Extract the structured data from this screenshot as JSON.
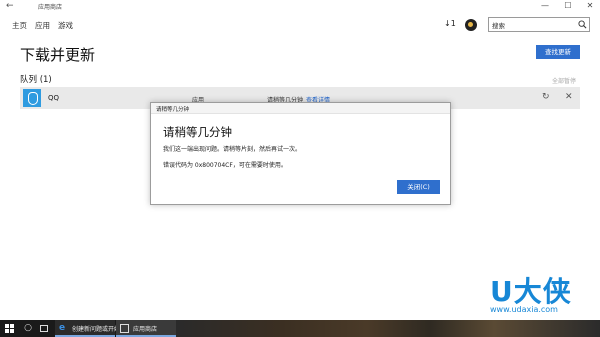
{
  "window": {
    "title": "应用商店",
    "back_icon": "back-arrow-icon",
    "controls": {
      "minimize": "—",
      "maximize": "☐",
      "close": "✕"
    }
  },
  "nav": {
    "items": [
      "主页",
      "应用",
      "游戏"
    ],
    "download_count": "1",
    "search": {
      "value": "搜索"
    }
  },
  "page": {
    "title": "下载并更新",
    "find_updates_label": "查找更新",
    "queue_title": "队列 (1)",
    "pause_all_label": "全部暂停"
  },
  "queue": [
    {
      "name": "QQ",
      "category": "应用",
      "status": "请稍等几分钟",
      "details_link": "查看详情"
    }
  ],
  "dialog": {
    "title": "请稍等几分钟",
    "heading": "请稍等几分钟",
    "message": "我们这一端出现问题。请稍等片刻，然后再试一次。",
    "error_code": "错误代码为 0x800704CF，可在需要时使用。",
    "close_label": "关闭(C)"
  },
  "watermark": {
    "logo": "U大侠",
    "url": "www.udaxia.com"
  },
  "taskbar": {
    "apps": [
      {
        "label": "创建新问题或开始...",
        "icon": "edge-icon"
      },
      {
        "label": "应用商店",
        "icon": "store-icon"
      }
    ]
  },
  "colors": {
    "accent": "#2f6fcd",
    "link": "#1e62c9",
    "watermark": "#1787d6",
    "taskbar": "#1a1a1a"
  }
}
